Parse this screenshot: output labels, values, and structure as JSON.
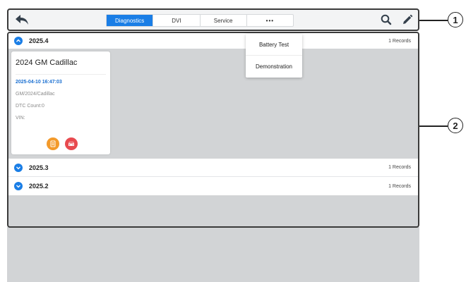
{
  "toolbar": {
    "tabs": [
      {
        "label": "Diagnostics",
        "active": true
      },
      {
        "label": "DVI",
        "active": false
      },
      {
        "label": "Service",
        "active": false
      },
      {
        "label": "•••",
        "active": false
      }
    ],
    "icons": [
      "back-arrow-icon",
      "search-icon",
      "edit-pencil-icon"
    ]
  },
  "dropdown_menu": {
    "items": [
      "Battery Test",
      "Demonstration"
    ]
  },
  "groups": [
    {
      "label": "2025.4",
      "records": "1 Records",
      "expanded": true,
      "cards": [
        {
          "title": "2024 GM Cadillac",
          "date": "2025-04-10 16:47:03",
          "path": "GM/2024/Cadillac",
          "dtc": "DTC Count:0",
          "vin": "VIN:"
        }
      ]
    },
    {
      "label": "2025.3",
      "records": "1 Records",
      "expanded": false
    },
    {
      "label": "2025.2",
      "records": "1 Records",
      "expanded": false
    }
  ],
  "callouts": [
    "1",
    "2"
  ],
  "colors": {
    "accent": "#1a7ee6",
    "panel_bg": "#d2d4d6",
    "report_icon": "#f39a2b",
    "car_icon": "#e84a4f"
  }
}
